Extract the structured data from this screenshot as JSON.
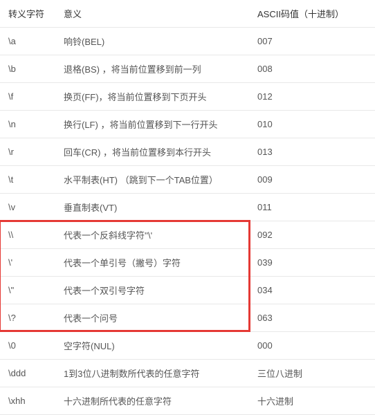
{
  "headers": {
    "escape": "转义字符",
    "meaning": "意义",
    "ascii": "ASCII码值（十进制）"
  },
  "rows": [
    {
      "escape": "\\a",
      "meaning": "响铃(BEL)",
      "ascii": "007"
    },
    {
      "escape": "\\b",
      "meaning": "退格(BS) ，将当前位置移到前一列",
      "ascii": "008"
    },
    {
      "escape": "\\f",
      "meaning": "换页(FF)，将当前位置移到下页开头",
      "ascii": "012"
    },
    {
      "escape": "\\n",
      "meaning": "换行(LF) ，将当前位置移到下一行开头",
      "ascii": "010"
    },
    {
      "escape": "\\r",
      "meaning": "回车(CR) ，将当前位置移到本行开头",
      "ascii": "013"
    },
    {
      "escape": "\\t",
      "meaning": "水平制表(HT) （跳到下一个TAB位置）",
      "ascii": "009"
    },
    {
      "escape": "\\v",
      "meaning": "垂直制表(VT)",
      "ascii": "011"
    },
    {
      "escape": "\\\\",
      "meaning": "代表一个反斜线字符''\\'",
      "ascii": "092"
    },
    {
      "escape": "\\'",
      "meaning": "代表一个单引号（撇号）字符",
      "ascii": "039"
    },
    {
      "escape": "\\\"",
      "meaning": "代表一个双引号字符",
      "ascii": "034"
    },
    {
      "escape": "\\?",
      "meaning": "代表一个问号",
      "ascii": "063"
    },
    {
      "escape": "\\0",
      "meaning": "空字符(NUL)",
      "ascii": "000"
    },
    {
      "escape": "\\ddd",
      "meaning": "1到3位八进制数所代表的任意字符",
      "ascii": "三位八进制"
    },
    {
      "escape": "\\xhh",
      "meaning": "十六进制所代表的任意字符",
      "ascii": "十六进制"
    }
  ],
  "highlight": {
    "startRow": 7,
    "endRow": 10
  }
}
